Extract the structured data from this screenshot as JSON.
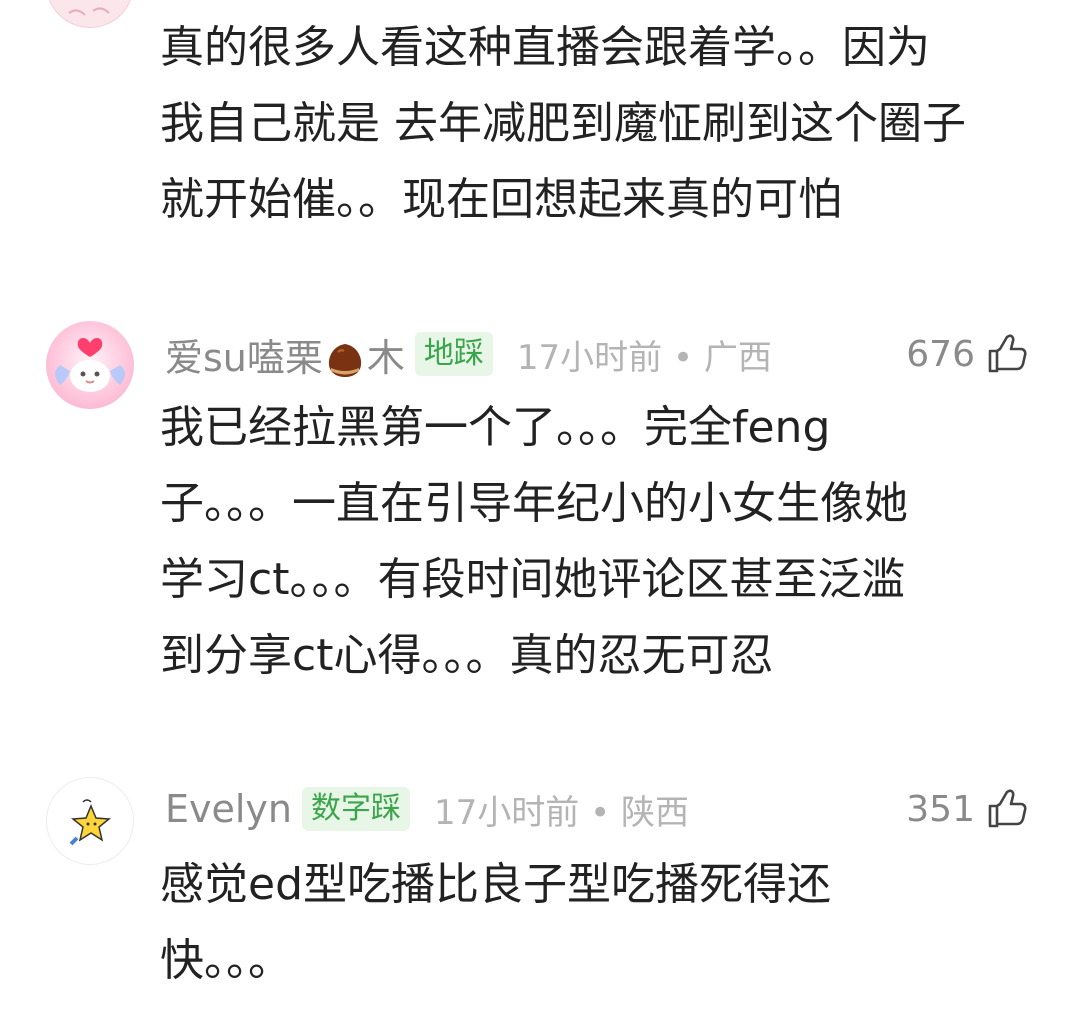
{
  "comments": [
    {
      "username": "",
      "badge": "",
      "time_location": "",
      "likes": "",
      "lines": [
        "真的很多人看这种直播会跟着学。。因为",
        "我自己就是 去年减肥到魔怔刷到这个圈子",
        "就开始催。。现在回想起来真的可怕"
      ]
    },
    {
      "username_before_emoji": "爱su嗑栗",
      "username_emoji": "chestnut-emoji",
      "username_after_emoji": "木",
      "badge": "地踩",
      "time_location": "17小时前 • 广西",
      "likes": "676",
      "lines": [
        "我已经拉黑第一个了。。。完全feng",
        "子。。。一直在引导年纪小的小女生像她",
        "学习ct。。。有段时间她评论区甚至泛滥",
        "到分享ct心得。。。真的忍无可忍"
      ]
    },
    {
      "username": "Evelyn",
      "badge": "数字踩",
      "time_location": "17小时前 • 陕西",
      "likes": "351",
      "lines": [
        "感觉ed型吃播比良子型吃播死得还",
        "快。。。"
      ]
    }
  ],
  "icons": {
    "like": "thumbs-up-icon"
  },
  "colors": {
    "badge_text": "#3aa54a",
    "badge_bg": "#e8f6e8",
    "meta_text": "#8a8a8a",
    "time_text": "#b4b4b4",
    "body_text": "#222222"
  }
}
